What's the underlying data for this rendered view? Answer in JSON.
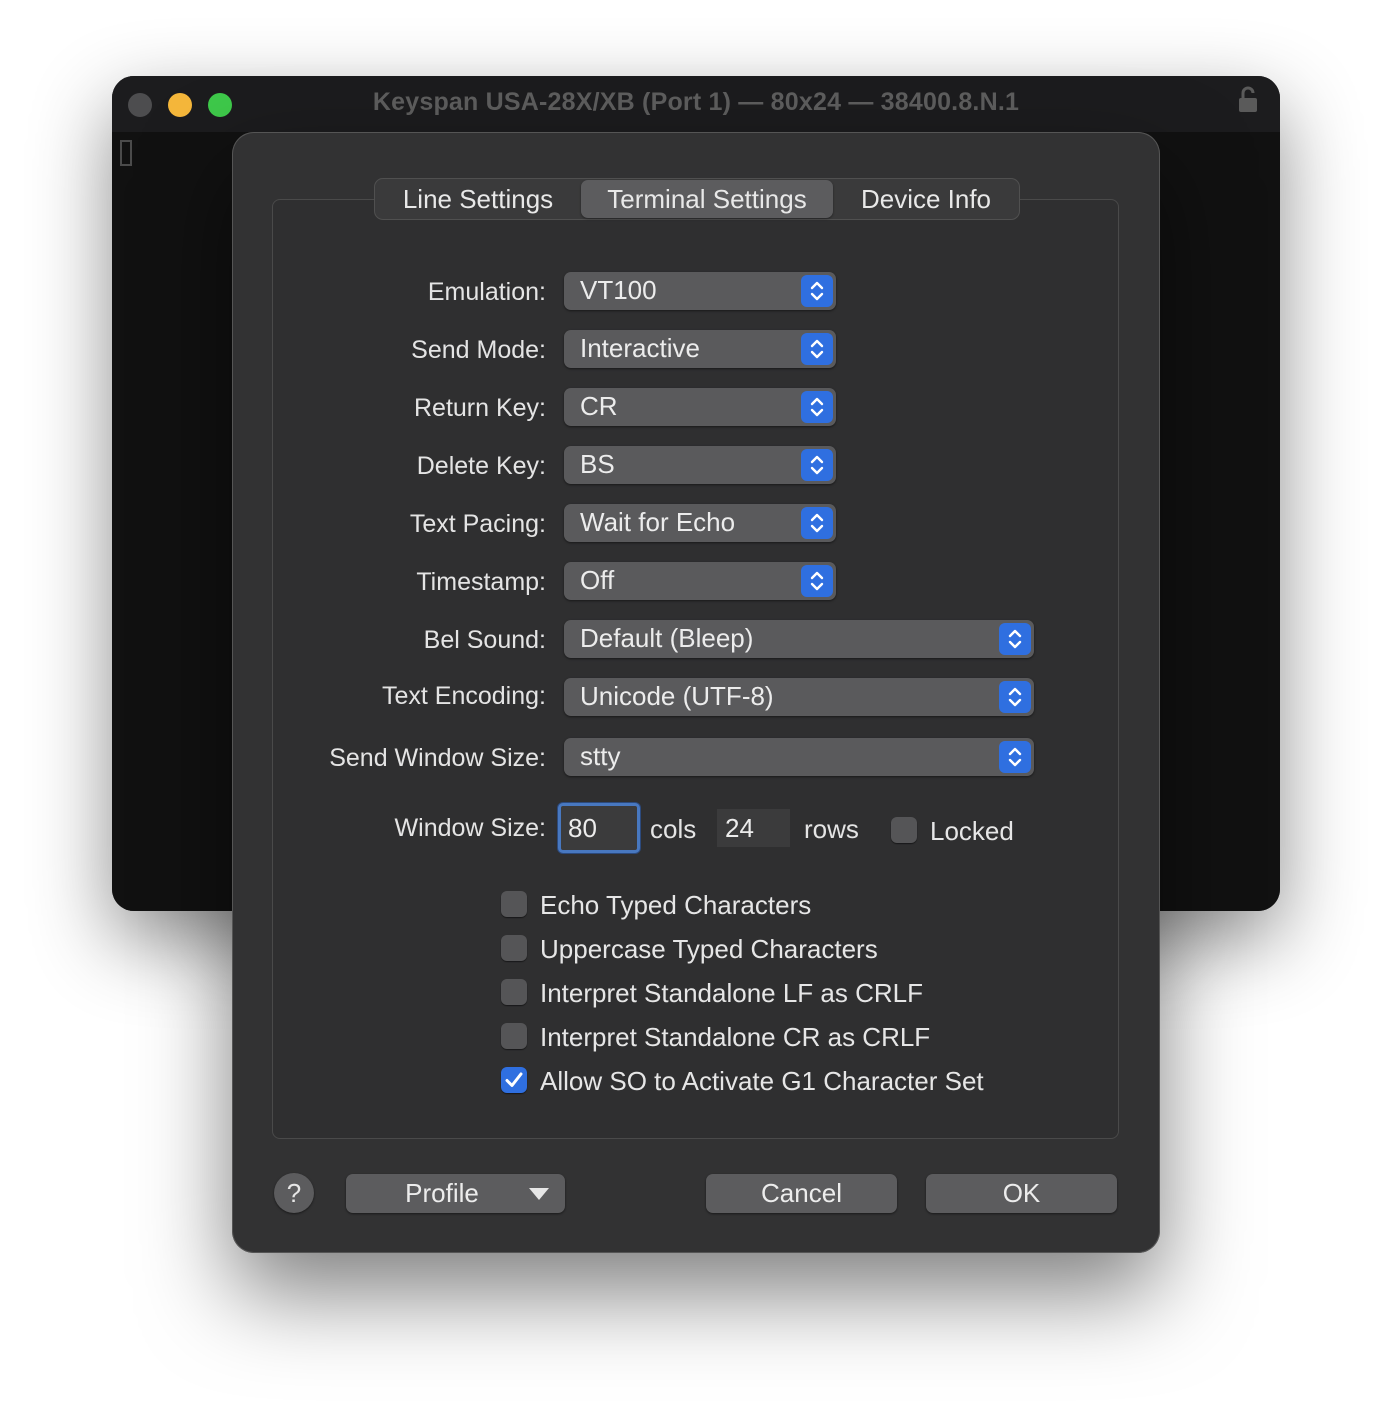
{
  "terminal": {
    "title": "Keyspan USA-28X/XB (Port 1) — 80x24 — 38400.8.N.1"
  },
  "tabs": [
    {
      "label": "Line Settings"
    },
    {
      "label": "Terminal Settings"
    },
    {
      "label": "Device Info"
    }
  ],
  "selected_tab": "Terminal Settings",
  "settings": {
    "emulation": {
      "label": "Emulation:",
      "value": "VT100"
    },
    "send_mode": {
      "label": "Send Mode:",
      "value": "Interactive"
    },
    "return_key": {
      "label": "Return Key:",
      "value": "CR"
    },
    "delete_key": {
      "label": "Delete Key:",
      "value": "BS"
    },
    "text_pacing": {
      "label": "Text Pacing:",
      "value": "Wait for Echo"
    },
    "timestamp": {
      "label": "Timestamp:",
      "value": "Off"
    },
    "bel_sound": {
      "label": "Bel Sound:",
      "value": "Default (Bleep)"
    },
    "text_encoding": {
      "label": "Text Encoding:",
      "value": "Unicode (UTF-8)"
    },
    "send_window_size": {
      "label": "Send Window Size:",
      "value": "stty"
    }
  },
  "window_size": {
    "label": "Window Size:",
    "cols": "80",
    "cols_unit": "cols",
    "rows": "24",
    "rows_unit": "rows",
    "locked_label": "Locked",
    "locked": false
  },
  "options": [
    {
      "label": "Echo Typed Characters",
      "checked": false
    },
    {
      "label": "Uppercase Typed Characters",
      "checked": false
    },
    {
      "label": "Interpret Standalone LF as CRLF",
      "checked": false
    },
    {
      "label": "Interpret Standalone CR as CRLF",
      "checked": false
    },
    {
      "label": "Allow SO to Activate G1 Character Set",
      "checked": true
    }
  ],
  "buttons": {
    "help": "?",
    "profile": "Profile",
    "cancel": "Cancel",
    "ok": "OK"
  },
  "colors": {
    "accent": "#2f6fe0",
    "sheet_bg": "#323233",
    "control_bg": "#5a5a5c"
  }
}
